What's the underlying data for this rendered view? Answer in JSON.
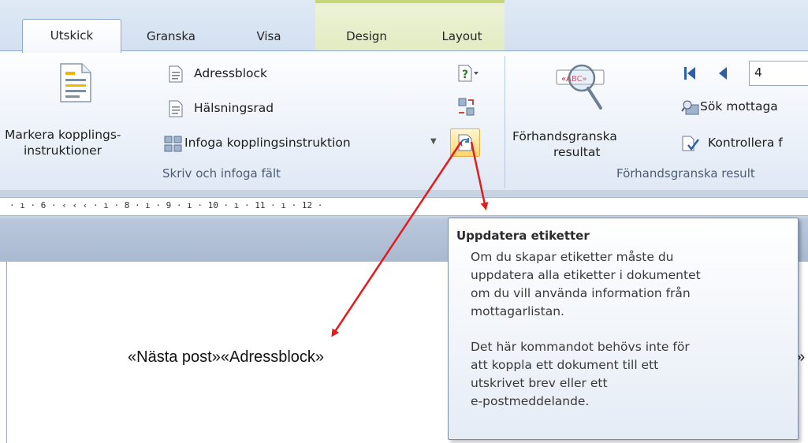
{
  "tabs": [
    {
      "label": "Utskick"
    },
    {
      "label": "Granska"
    },
    {
      "label": "Visa"
    },
    {
      "label": "Design"
    },
    {
      "label": "Layout"
    }
  ],
  "ribbon": {
    "markera": {
      "line1": "Markera kopplings-",
      "line2": "instruktioner"
    },
    "adressblock": "Adressblock",
    "halsningsrad": "Hälsningsrad",
    "infoga": "Infoga kopplingsinstruktion",
    "group_skriv": "Skriv och infoga fält",
    "forhandsgranska": {
      "line1": "Förhandsgranska",
      "line2": "resultat"
    },
    "record_number": "4",
    "sok": "Sök mottaga",
    "kontrollera": "Kontrollera f",
    "group_forhand": "Förhandsgranska result"
  },
  "ruler": {
    "ticks": "· ı · 6 · ‹ ‹ ‹ · ı · 8 · ı · 9 · ı · 10 · ı · 11 · ı · 12 ·"
  },
  "tooltip": {
    "title": "Uppdatera etiketter",
    "para1": [
      "Om du skapar etiketter måste du",
      "uppdatera alla etiketter i dokumentet",
      "om du vill använda information från",
      "mottagarlistan."
    ],
    "para2": [
      "Det här kommandot behövs inte för",
      "att koppla ett dokument till ett",
      "utskrivet brev eller ett",
      "e-postmeddelande."
    ]
  },
  "document": {
    "merge_fields": "«Nästa post»«Adressblock»",
    "right_fragment": "»"
  },
  "colors": {
    "annotation_arrow": "#e31b1b",
    "ribbon_border": "#8eaad0",
    "design_context": "#c4d67a"
  }
}
